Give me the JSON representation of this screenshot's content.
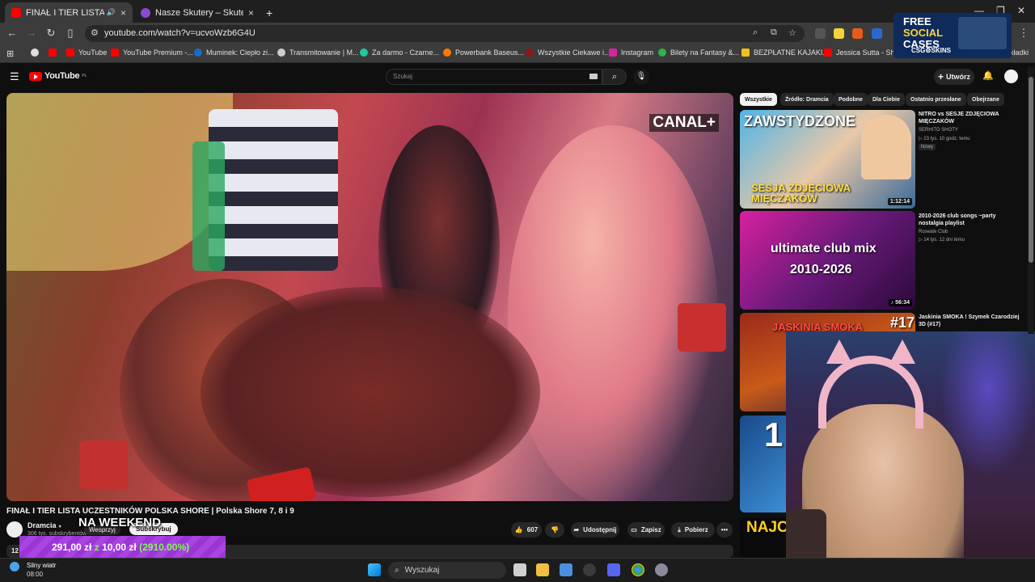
{
  "browser": {
    "tabs": [
      {
        "title": "FINAŁ I TIER LISTA UCZESTN",
        "active": true,
        "audio": "🔊"
      },
      {
        "title": "Nasze Skutery – Skutery Zegrze",
        "active": false
      }
    ],
    "new_tab_glyph": "+",
    "url": "youtube.com/watch?v=ucvoWzb6G4U",
    "bookmarks": [
      {
        "label": "YouTube",
        "color": "#ff0000"
      },
      {
        "label": "YouTube Premium -...",
        "color": "#ff0000"
      },
      {
        "label": "Muminek: Ciepło zi...",
        "color": "#1b6ac9"
      },
      {
        "label": "Transmitowanie | M...",
        "color": "#cccccc"
      },
      {
        "label": "Za darmo - Czarne...",
        "color": "#1ec9a0"
      },
      {
        "label": "Powerbank Baseus...",
        "color": "#ff7a00"
      },
      {
        "label": "Wszystkie Ciekawe i...",
        "color": "#8a1818"
      },
      {
        "label": "Instagram",
        "color": "#d6249f"
      },
      {
        "label": "Bilety na Fantasy &...",
        "color": "#2fb24c"
      },
      {
        "label": "BEZPŁATNE KAJAKI...",
        "color": "#f0c020"
      },
      {
        "label": "Jessica Sutta - Show",
        "color": "#ff0000"
      },
      {
        "label": "Zakładki",
        "color": "#d0d0d0"
      }
    ]
  },
  "ad": {
    "line1": "FREE",
    "line2": "SOCIAL",
    "line3": "CASES",
    "brand": "CSG⚙SKINS"
  },
  "youtube": {
    "logo": "YouTube",
    "logo_region": "PL",
    "search_placeholder": "Szukaj",
    "create_label": "Utwórz"
  },
  "video": {
    "title": "FINAŁ I TIER LISTA UCZESTNIKÓW POLSKA SHORE | Polska Shore 7, 8 i 9",
    "watermark": "CANAL+",
    "channel": "Dramcia",
    "subscribers": "306 tys. subskrybentów",
    "support_label": "Wesprzyj",
    "subscribe_label": "Subskrybuj",
    "likes": "607",
    "share_label": "Udostępnij",
    "save_label": "Zapisz",
    "download_label": "Pobierz",
    "more_label": "•••",
    "stub": "12"
  },
  "overlays": {
    "weekend_text": "NA WEEKEND",
    "donation_amount": "291,00 zł",
    "donation_z": "z",
    "donation_goal": "10,00 zł",
    "donation_pct": "(2910.00%)"
  },
  "sidebar": {
    "chips": [
      "Wszystkie",
      "Źródło: Dramcia",
      "Podobne",
      "Dla Ciebie",
      "Ostatnio przesłane",
      "Obejrzane"
    ],
    "videos": [
      {
        "title": "NITRO vs SESJE ZDJĘCIOWA MIĘCZAKÓW",
        "channel": "SERHITO SHOTY",
        "meta": "23 tys.   10 godz. temu",
        "badge": "Nowy",
        "duration": "1:12:14",
        "thumb_top": "ZAWSTYDZONE",
        "thumb_bottom": "SESJA ZDJĘCIOWA MIĘCZAKÓW"
      },
      {
        "title": "2010-2026 club songs ~party nostalgia playlist",
        "channel": "Roseate Club",
        "meta": "14 tys.   12 dni temu",
        "duration": "56:34",
        "thumb_top": "ultimate club mix",
        "thumb_bottom": "2010-2026"
      },
      {
        "title": "Jaskinia SMOKA ! Szymek Czarodziej 3D (#17)",
        "thumb_top": "JASKINIA SMOKA",
        "thumb_bottom": "#17"
      },
      {
        "thumb_top": "1"
      },
      {
        "thumb_top": "NAJC"
      }
    ]
  },
  "taskbar": {
    "weather_line1": "Silny wiatr",
    "weather_line2": "08:00",
    "search_placeholder": "Wyszukaj"
  }
}
